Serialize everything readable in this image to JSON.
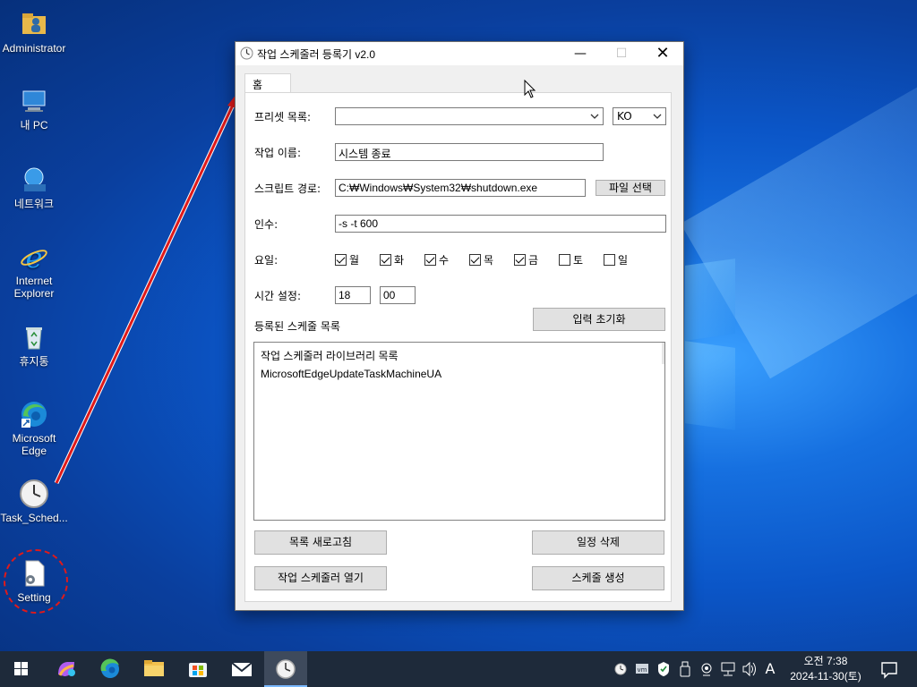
{
  "desktop": {
    "icons": [
      {
        "label": "Administrator"
      },
      {
        "label": "내 PC"
      },
      {
        "label": "네트워크"
      },
      {
        "label_line1": "Internet",
        "label_line2": "Explorer"
      },
      {
        "label": "휴지통"
      },
      {
        "label_line1": "Microsoft",
        "label_line2": "Edge"
      },
      {
        "label": "Task_Sched..."
      },
      {
        "label": "Setting"
      }
    ]
  },
  "window": {
    "title": "작업 스케줄러 등록기 v2.0",
    "controls": {
      "minimize": "—",
      "maximize": "☐",
      "close": "✕"
    },
    "tab": "홈",
    "form": {
      "preset_label": "프리셋 목록:",
      "preset_value": "",
      "lang_value": "KO",
      "task_name_label": "작업 이름:",
      "task_name_value": "시스템 종료",
      "script_path_label": "스크립트 경로:",
      "script_path_value": "C:₩Windows₩System32₩shutdown.exe",
      "file_select_button": "파일 선택",
      "args_label": "인수:",
      "args_value": "-s -t 600",
      "days_label": "요일:",
      "days": [
        {
          "label": "월",
          "checked": true
        },
        {
          "label": "화",
          "checked": true
        },
        {
          "label": "수",
          "checked": true
        },
        {
          "label": "목",
          "checked": true
        },
        {
          "label": "금",
          "checked": true
        },
        {
          "label": "토",
          "checked": false
        },
        {
          "label": "일",
          "checked": false
        }
      ],
      "time_label": "시간 설정:",
      "hour_value": "18",
      "minute_value": "00",
      "registered_label": "등록된 스케줄 목록",
      "reset_button": "입력 초기화"
    },
    "schedule_list": [
      "작업 스케줄러 라이브러리 목록",
      "MicrosoftEdgeUpdateTaskMachineUA"
    ],
    "buttons": {
      "refresh": "목록 새로고침",
      "delete": "일정 삭제",
      "open_scheduler": "작업 스케줄러 열기",
      "create": "스케줄 생성"
    }
  },
  "taskbar": {
    "ime": "A",
    "clock_time": "오전 7:38",
    "clock_date": "2024-11-30(토)"
  },
  "colors": {
    "annotation_red": "#e01a1a",
    "taskbar_bg": "#1e2a3a",
    "desktop_blue": "#0b56c8"
  }
}
